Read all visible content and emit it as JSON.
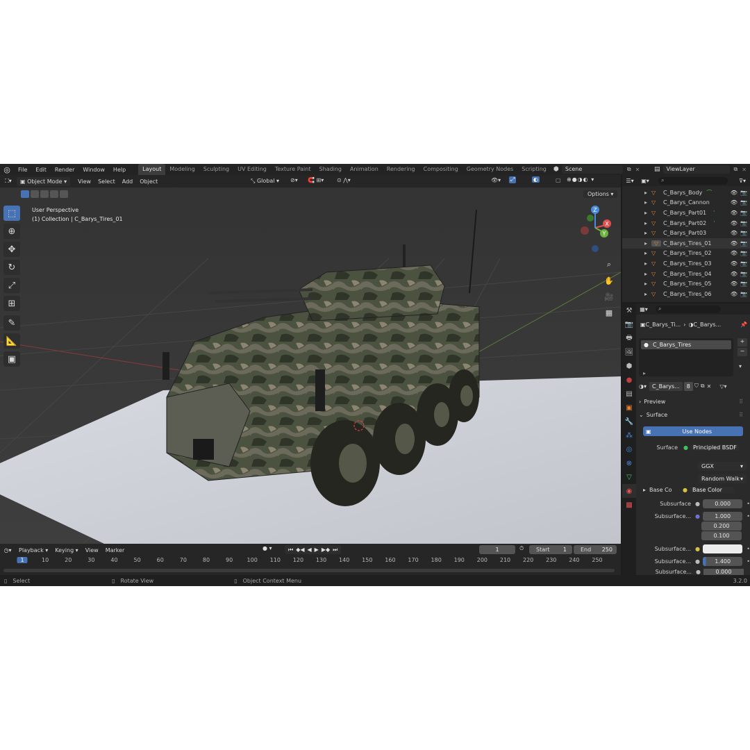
{
  "menu": [
    "File",
    "Edit",
    "Render",
    "Window",
    "Help"
  ],
  "workspaces": [
    "Layout",
    "Modeling",
    "Sculpting",
    "UV Editing",
    "Texture Paint",
    "Shading",
    "Animation",
    "Rendering",
    "Compositing",
    "Geometry Nodes",
    "Scripting"
  ],
  "scene": "Scene",
  "view_layer": "ViewLayer",
  "viewport": {
    "mode": "Object Mode",
    "header_menu": [
      "View",
      "Select",
      "Add",
      "Object"
    ],
    "orientation": "Global",
    "options": "Options",
    "perspective": "User Perspective",
    "collection": "(1) Collection | C_Barys_Tires_01",
    "gizmo": {
      "x": "X",
      "y": "Y",
      "z": "Z"
    }
  },
  "timeline": {
    "menu": [
      "Playback",
      "Keying",
      "View",
      "Marker"
    ],
    "current_frame": "1",
    "start_label": "Start",
    "start": "1",
    "end_label": "End",
    "end": "250",
    "ticks": [
      "1",
      "10",
      "20",
      "30",
      "40",
      "50",
      "60",
      "70",
      "80",
      "90",
      "100",
      "110",
      "120",
      "130",
      "140",
      "150",
      "160",
      "170",
      "180",
      "190",
      "200",
      "210",
      "220",
      "230",
      "240",
      "250"
    ]
  },
  "outliner": {
    "items": [
      {
        "name": "C_Barys_Body",
        "selected": false
      },
      {
        "name": "C_Barys_Cannon",
        "selected": false
      },
      {
        "name": "C_Barys_Part01",
        "selected": false
      },
      {
        "name": "C_Barys_Part02",
        "selected": false
      },
      {
        "name": "C_Barys_Part03",
        "selected": false
      },
      {
        "name": "C_Barys_Tires_01",
        "selected": true
      },
      {
        "name": "C_Barys_Tires_02",
        "selected": false
      },
      {
        "name": "C_Barys_Tires_03",
        "selected": false
      },
      {
        "name": "C_Barys_Tires_04",
        "selected": false
      },
      {
        "name": "C_Barys_Tires_05",
        "selected": false
      },
      {
        "name": "C_Barys_Tires_06",
        "selected": false
      }
    ]
  },
  "properties": {
    "breadcrumb_object": "C_Barys_Ti...",
    "breadcrumb_material": "C_Barys...",
    "material_slot": "C_Barys_Tires",
    "material_name": "C_Barys...",
    "user_count": "8",
    "preview": "Preview",
    "surface_panel": "Surface",
    "use_nodes": "Use Nodes",
    "surface_label": "Surface",
    "surface_value": "Principled BSDF",
    "distribution": "GGX",
    "subsurface_method": "Random Walk",
    "base_color_label": "Base Co",
    "base_color_value": "Base Color",
    "subsurface_label": "Subsurface",
    "subsurface_value": "0.000",
    "subsurface_radius_label": "Subsurface...",
    "radius": [
      "1.000",
      "0.200",
      "0.100"
    ],
    "subsurface_color_label": "Subsurface...",
    "subsurface_ior_label": "Subsurface...",
    "subsurface_ior": "1.400",
    "subsurface_aniso_label": "Subsurface...",
    "subsurface_aniso": "0.000"
  },
  "status": {
    "select": "Select",
    "rotate": "Rotate View",
    "context": "Object Context Menu",
    "version": "3.2.0"
  },
  "colors": {
    "accent": "#4772b3",
    "header": "#262626",
    "viewport_bg": "#3c3c3c",
    "plane": "#c8cad2"
  }
}
